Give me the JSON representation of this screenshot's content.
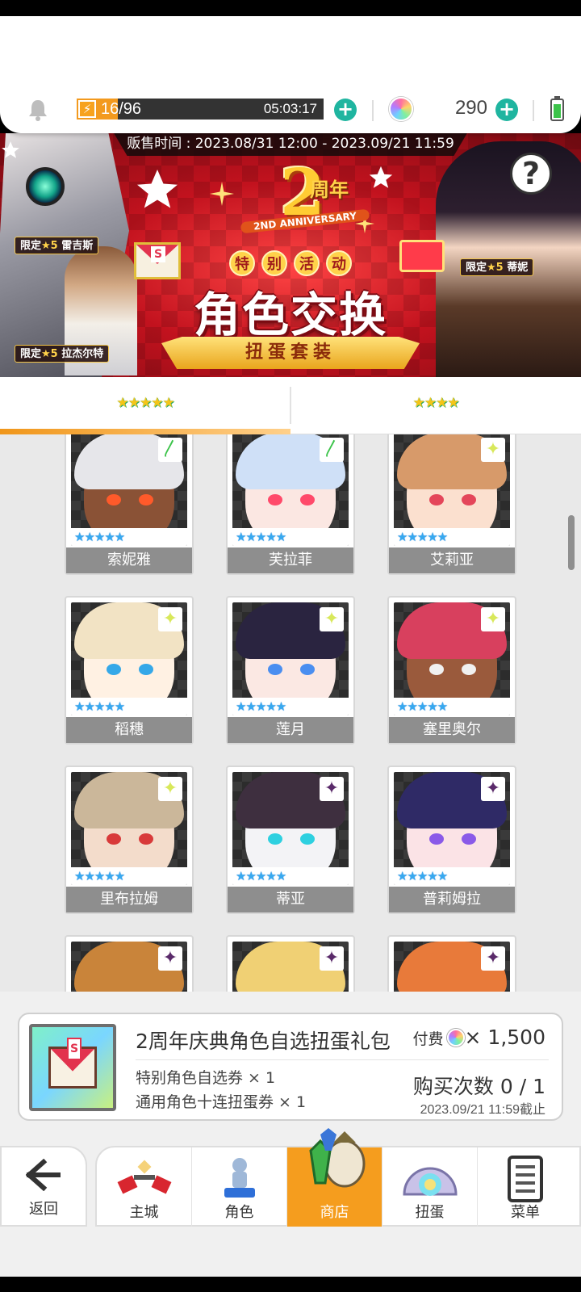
{
  "header": {
    "stamina": "16/96",
    "stamina_fill": 0.166,
    "timer": "05:03:17",
    "gems": "290"
  },
  "banner": {
    "sale_time": "贩售时间 : 2023.08/31 12:00 - 2023.09/21 11:59",
    "anniv_num": "2",
    "anniv_zh": "周年",
    "anniv_en": "2ND ANNIVERSARY",
    "event_chars": [
      "特",
      "别",
      "活",
      "动"
    ],
    "title": "角色交换",
    "subtitle": "扭蛋套装",
    "tags": [
      {
        "prefix": "限定",
        "star": "★5",
        "name": "雷吉斯"
      },
      {
        "prefix": "限定",
        "star": "★5",
        "name": "拉杰尔特"
      },
      {
        "prefix": "限定",
        "star": "★5",
        "name": "蒂妮"
      }
    ],
    "help": "?"
  },
  "tabs": [
    {
      "stars": "★★★★★",
      "active": true
    },
    {
      "stars": "★★★★",
      "active": false
    }
  ],
  "characters": [
    {
      "name": "索妮雅",
      "rarity": "★★★★★",
      "badge": "leaf-icon",
      "hair": "#e6e6ea",
      "skin": "#8a5236",
      "eye": "#ff5a2a"
    },
    {
      "name": "芙拉菲",
      "rarity": "★★★★★",
      "badge": "leaf-icon",
      "hair": "#cfe0f7",
      "skin": "#fbe7e2",
      "eye": "#ff4a6a"
    },
    {
      "name": "艾莉亚",
      "rarity": "★★★★★",
      "badge": "sparkle-icon",
      "hair": "#d79a6a",
      "skin": "#fbe0cf",
      "eye": "#e4465a"
    },
    {
      "name": "稻穗",
      "rarity": "★★★★★",
      "badge": "sparkle-icon",
      "hair": "#f2e3c4",
      "skin": "#fff1e3",
      "eye": "#35a8e8"
    },
    {
      "name": "莲月",
      "rarity": "★★★★★",
      "badge": "sparkle-icon",
      "hair": "#2a2440",
      "skin": "#fbe8e3",
      "eye": "#4a8ef0"
    },
    {
      "name": "塞里奥尔",
      "rarity": "★★★★★",
      "badge": "sparkle-icon",
      "hair": "#d8405e",
      "skin": "#9a5a3c",
      "eye": "#f0f0f0"
    },
    {
      "name": "里布拉姆",
      "rarity": "★★★★★",
      "badge": "sparkle-icon",
      "hair": "#cbb79a",
      "skin": "#f3dccb",
      "eye": "#d83a3a"
    },
    {
      "name": "蒂亚",
      "rarity": "★★★★★",
      "badge": "star4-icon",
      "hair": "#3e2f3f",
      "skin": "#f3f3f6",
      "eye": "#2ed0e0"
    },
    {
      "name": "普莉姆拉",
      "rarity": "★★★★★",
      "badge": "star4-icon",
      "hair": "#2f2a66",
      "skin": "#fbe3e6",
      "eye": "#8a5ae8"
    },
    {
      "name": "",
      "rarity": "",
      "badge": "star4-icon",
      "hair": "#c9843a",
      "skin": "#f3dccb",
      "eye": "#333"
    },
    {
      "name": "",
      "rarity": "",
      "badge": "star4-icon",
      "hair": "#f0d074",
      "skin": "#f3dccb",
      "eye": "#333"
    },
    {
      "name": "",
      "rarity": "",
      "badge": "star4-icon",
      "hair": "#e87a3a",
      "skin": "#f3dccb",
      "eye": "#333"
    }
  ],
  "item": {
    "title": "2周年庆典角色自选扭蛋礼包",
    "pay_label": "付费",
    "price": "× 1,500",
    "line1": "特别角色自选券 × 1",
    "line2": "通用角色十连扭蛋券 × 1",
    "purchase_count": "购买次数 0 / 1",
    "deadline": "2023.09/21 11:59截止"
  },
  "nav": {
    "back": "返回",
    "items": [
      "主城",
      "角色",
      "商店",
      "扭蛋",
      "菜单"
    ],
    "active_index": 2
  },
  "colors": {
    "accent": "#f59d1e",
    "teal": "#1fb5a0",
    "banner_red": "#c2121e"
  }
}
